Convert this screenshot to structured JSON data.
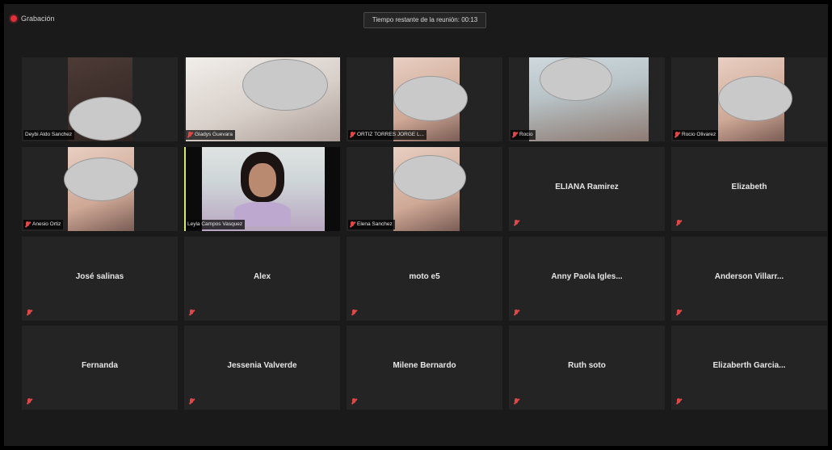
{
  "recording": {
    "label": "Grabación"
  },
  "timer": {
    "text": "Tiempo restante de la reunión: 00:13"
  },
  "video_tiles": [
    {
      "name": "Deybi Aldo Sanchez"
    },
    {
      "name": "Gladys Guevara"
    },
    {
      "name": "ORTIZ TORRES JORGE L..."
    },
    {
      "name": "Rocio"
    },
    {
      "name": "Rocio Olivarez"
    },
    {
      "name": "Anesio Ortiz"
    },
    {
      "name": "Leyla Campos Vasquez"
    },
    {
      "name": "Elena Sanchez"
    }
  ],
  "name_tiles": [
    "ELIANA Ramirez",
    "Elizabeth",
    "José salinas",
    "Alex",
    "moto e5",
    "Anny Paola Igles...",
    "Anderson Villarr...",
    "Fernanda",
    "Jessenia Valverde",
    "Milene Bernardo",
    "Ruth soto",
    "Elizaberth Garcia..."
  ],
  "colors": {
    "active_speaker_border": "#d7e86a",
    "muted_icon": "#e04848",
    "recording_dot": "#e0303a"
  }
}
